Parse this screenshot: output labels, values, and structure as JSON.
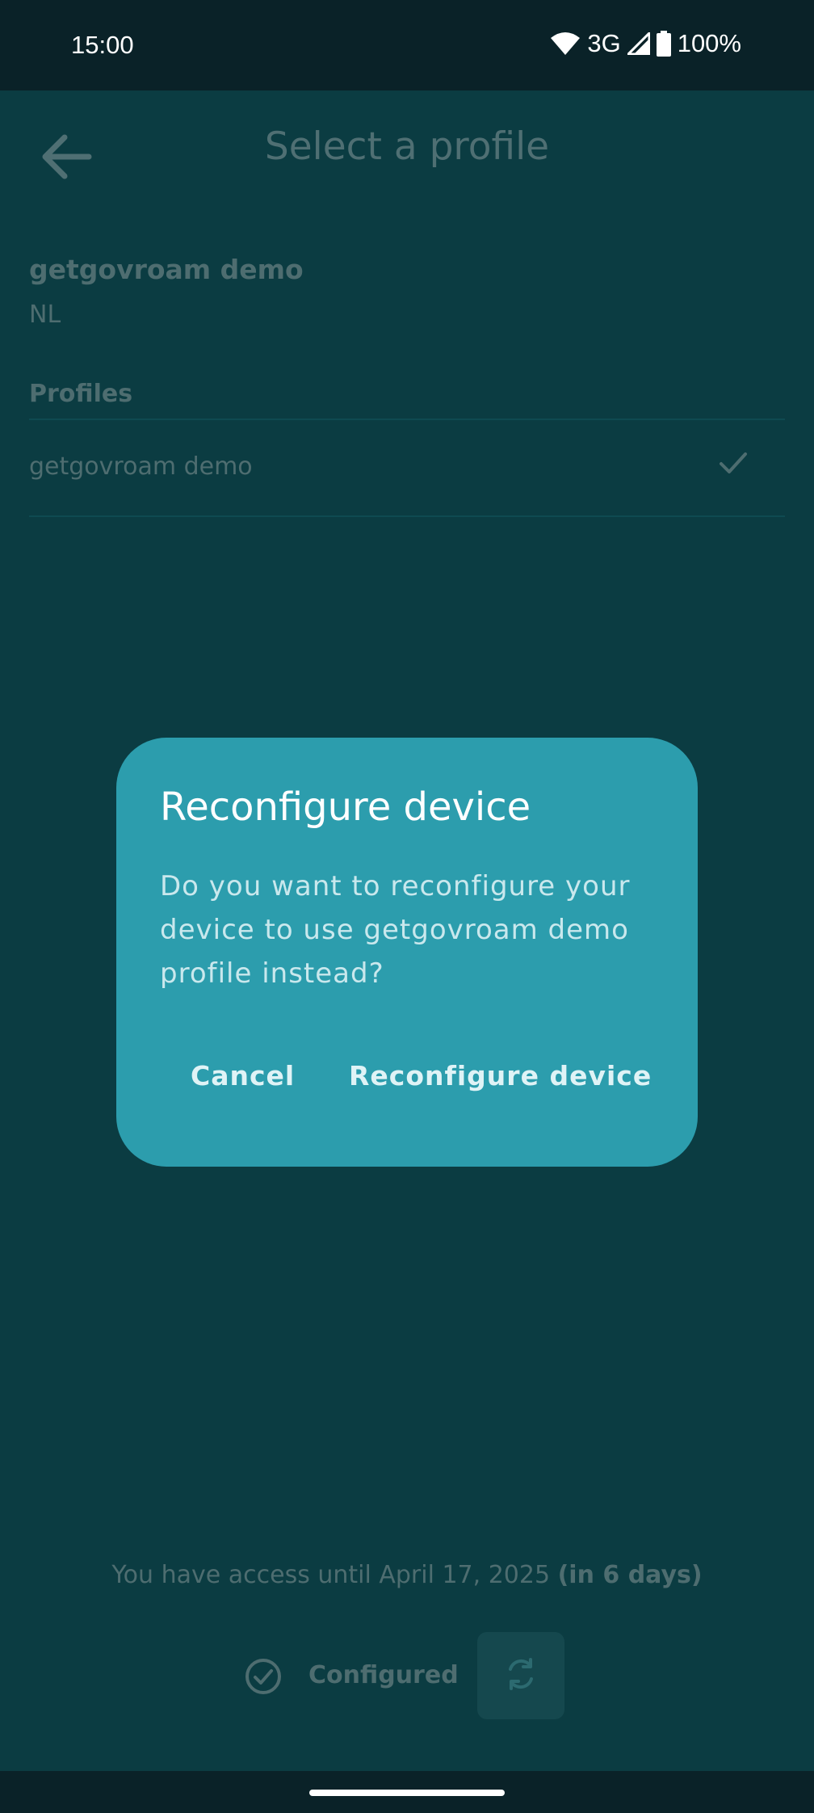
{
  "status_bar": {
    "time": "15:00",
    "network": "3G",
    "battery": "100%"
  },
  "header": {
    "title": "Select a profile",
    "back_icon": "arrow-left-icon"
  },
  "institution": {
    "name": "getgovroam demo",
    "country": "NL"
  },
  "profiles": {
    "header": "Profiles",
    "items": [
      {
        "name": "getgovroam demo",
        "selected_icon": "check-icon"
      }
    ]
  },
  "footer": {
    "access_prefix": "You have access until April 17, 2025 ",
    "access_days": "(in 6 days)",
    "status_label": "Configured",
    "status_icon": "check-circle-icon",
    "refresh_icon": "refresh-icon"
  },
  "dialog": {
    "title": "Reconfigure device",
    "message": "Do you want to reconfigure your device to use getgovroam demo profile instead?",
    "cancel_label": "Cancel",
    "confirm_label": "Reconfigure device"
  },
  "colors": {
    "background": "#0b3c42",
    "dialog": "#2c9dad",
    "status_bar": "#0a2228"
  }
}
